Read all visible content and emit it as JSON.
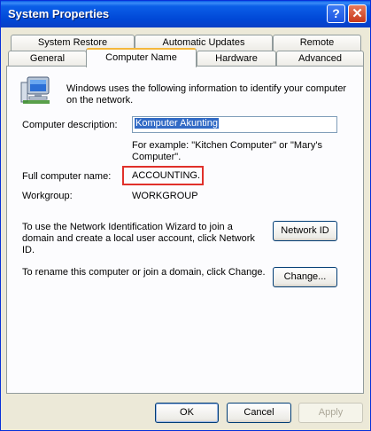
{
  "window": {
    "title": "System Properties",
    "help_glyph": "?",
    "close_glyph": "✕"
  },
  "tabs_row1": [
    {
      "label": "System Restore"
    },
    {
      "label": "Automatic Updates"
    },
    {
      "label": "Remote"
    }
  ],
  "tabs_row2": [
    {
      "label": "General"
    },
    {
      "label": "Computer Name"
    },
    {
      "label": "Hardware"
    },
    {
      "label": "Advanced"
    }
  ],
  "panel": {
    "intro": "Windows uses the following information to identify your computer on the network.",
    "desc_label": "Computer description:",
    "desc_value": "Komputer Akunting",
    "desc_example": "For example: \"Kitchen Computer\" or \"Mary's Computer\".",
    "fullname_label": "Full computer name:",
    "fullname_value": "ACCOUNTING.",
    "workgroup_label": "Workgroup:",
    "workgroup_value": "WORKGROUP",
    "wizard_text": "To use the Network Identification Wizard to join a domain and create a local user account, click Network ID.",
    "network_id_button": "Network ID",
    "rename_text": "To rename this computer or join a domain, click Change.",
    "change_button": "Change..."
  },
  "footer": {
    "ok": "OK",
    "cancel": "Cancel",
    "apply": "Apply"
  },
  "colors": {
    "title_bar": "#0054e3",
    "highlight": "#e0302a",
    "active_tab_accent": "#f5b73a"
  }
}
